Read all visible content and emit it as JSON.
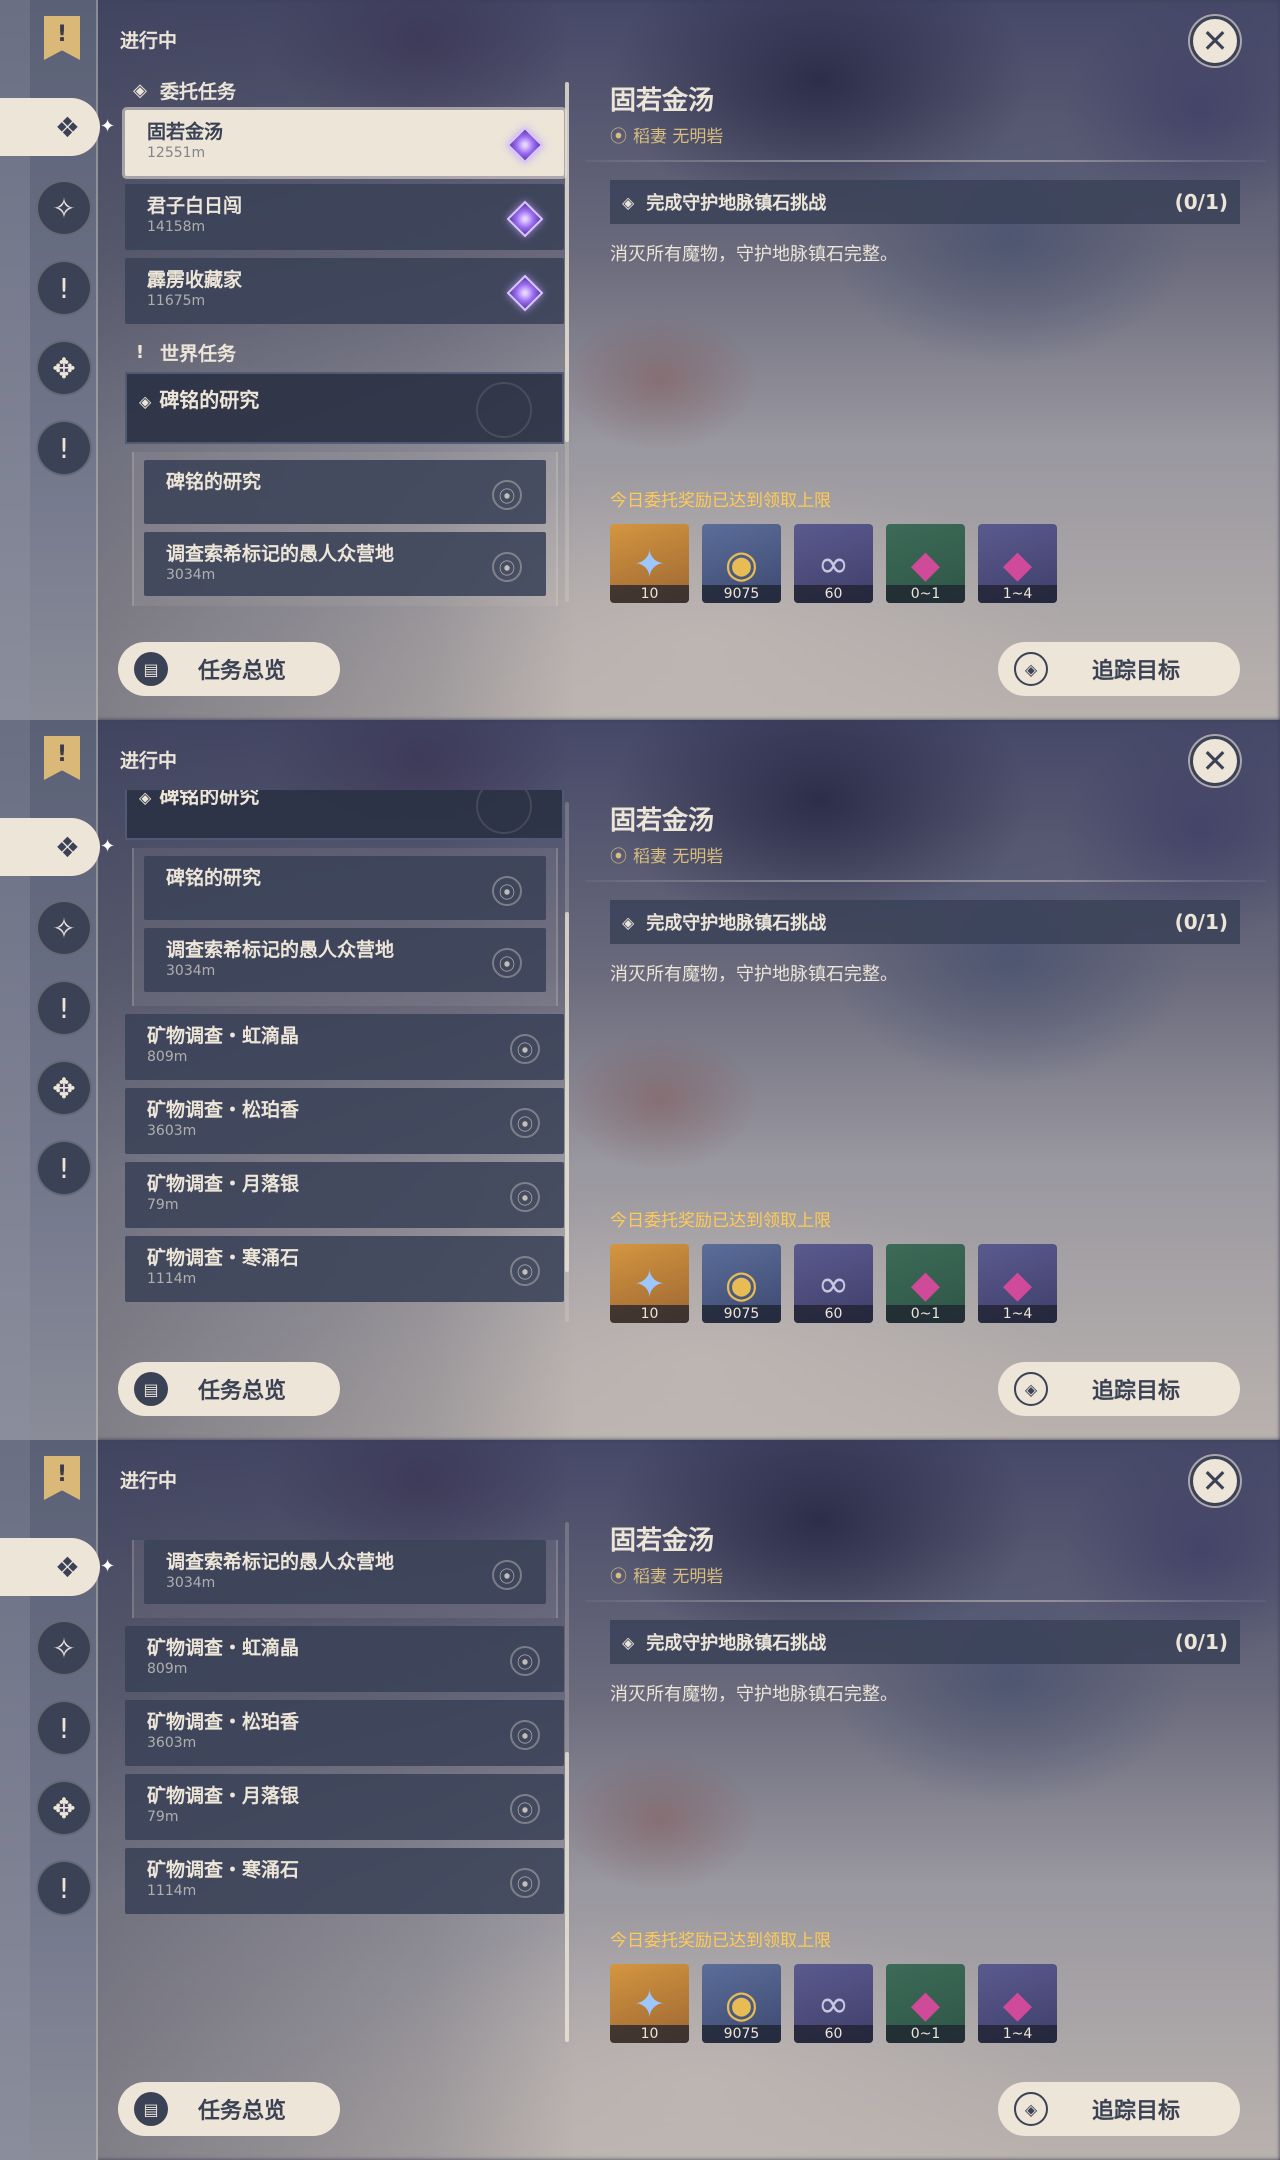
{
  "status_label": "进行中",
  "close_icon": "close-icon",
  "sections": {
    "commission": "委托任务",
    "world": "世界任务"
  },
  "commissions": [
    {
      "title": "固若金汤",
      "dist": "12551m"
    },
    {
      "title": "君子白日闯",
      "dist": "14158m"
    },
    {
      "title": "霹雳收藏家",
      "dist": "11675m"
    }
  ],
  "world_quest": {
    "title": "碑铭的研究",
    "steps": [
      {
        "title": "碑铭的研究",
        "dist": ""
      },
      {
        "title": "调查索希标记的愚人众营地",
        "dist": "3034m"
      }
    ]
  },
  "mineral_quests": [
    {
      "title": "矿物调查・虹滴晶",
      "dist": "809m"
    },
    {
      "title": "矿物调查・松珀香",
      "dist": "3603m"
    },
    {
      "title": "矿物调查・月落银",
      "dist": "79m"
    },
    {
      "title": "矿物调查・寒涌石",
      "dist": "1114m"
    }
  ],
  "detail": {
    "title": "固若金汤",
    "location": "稻妻 无明砦",
    "objective": "完成守护地脉镇石挑战",
    "progress": "(0/1)",
    "description": "消灭所有魔物，守护地脉镇石完整。",
    "reward_note": "今日委托奖励已达到领取上限",
    "rewards": [
      {
        "icon": "primogem-icon",
        "glyph": "✦",
        "count": "10",
        "tone": "gold"
      },
      {
        "icon": "mora-icon",
        "glyph": "◉",
        "count": "9075",
        "tone": "blue"
      },
      {
        "icon": "exp-icon",
        "glyph": "∞",
        "count": "60",
        "tone": "purple"
      },
      {
        "icon": "crystal-icon",
        "glyph": "◆",
        "count": "0~1",
        "tone": "green"
      },
      {
        "icon": "crystal-cluster-icon",
        "glyph": "◆",
        "count": "1~4",
        "tone": "purple"
      }
    ]
  },
  "buttons": {
    "overview": "任务总览",
    "track": "追踪目标"
  },
  "colors": {
    "panel_cream": "#ece5d8",
    "panel_dark": "#3b4255",
    "gold_text": "#ffcb55",
    "location_text": "#d7bd7e"
  }
}
